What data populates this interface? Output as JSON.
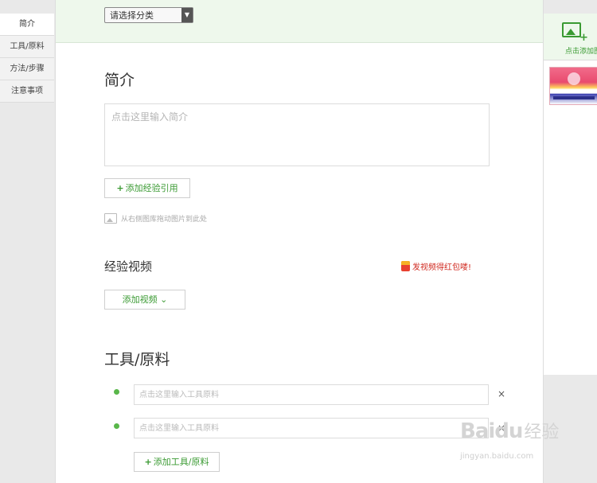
{
  "sidebar": {
    "items": [
      {
        "label": "简介"
      },
      {
        "label": "工具/原料"
      },
      {
        "label": "方法/步骤"
      },
      {
        "label": "注意事项"
      }
    ]
  },
  "category": {
    "selected": "请选择分类",
    "arrow": "▼"
  },
  "intro": {
    "title": "简介",
    "placeholder": "点击这里输入简介",
    "add_reference_button": "添加经验引用",
    "plus": "+",
    "drag_hint": "从右侧图库拖动图片到此处"
  },
  "video": {
    "title": "经验视频",
    "promo": "发视频得红包喽!",
    "add_video_button": "添加视频",
    "chevron": "⌄"
  },
  "tools": {
    "title": "工具/原料",
    "items": [
      {
        "placeholder": "点击这里输入工具原料",
        "remove": "×"
      },
      {
        "placeholder": "点击这里输入工具原料",
        "remove": "×"
      }
    ],
    "add_button": "添加工具/原料",
    "plus": "+"
  },
  "right_panel": {
    "add_image_label": "点击添加图片"
  },
  "watermark": {
    "brand": "Baidu",
    "jy": "经验",
    "url": "jingyan.baidu.com"
  },
  "colors": {
    "accent_green": "#3a9a32",
    "top_band": "#eef8ec",
    "promo_red": "#d02a20"
  }
}
